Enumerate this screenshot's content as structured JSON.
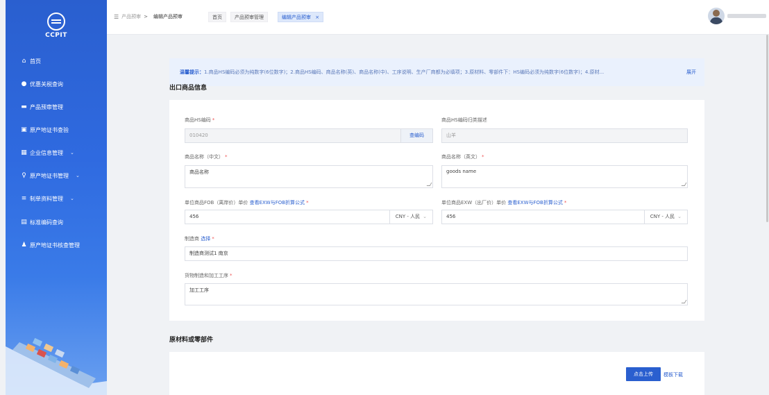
{
  "sidebar": {
    "logo_text": "CCPIT",
    "items": [
      {
        "label": "首页",
        "icon": "home-icon"
      },
      {
        "label": "优惠关税查询",
        "icon": "search-icon"
      },
      {
        "label": "产品预审管理",
        "icon": "folder-icon"
      },
      {
        "label": "原产地证书查验",
        "icon": "document-check-icon"
      },
      {
        "label": "企业信息管理",
        "icon": "building-icon"
      },
      {
        "label": "原产地证书管理",
        "icon": "user-cert-icon"
      },
      {
        "label": "制单资料管理",
        "icon": "stack-icon"
      },
      {
        "label": "标准编码查询",
        "icon": "code-icon"
      },
      {
        "label": "原产地证书核查管理",
        "icon": "person-icon"
      }
    ]
  },
  "header": {
    "breadcrumb_parent": "产品预审",
    "breadcrumb_separator": ">",
    "breadcrumb_current": "编辑产品预审",
    "tabs": [
      {
        "label": "首页"
      },
      {
        "label": "产品预审管理"
      },
      {
        "label": "编辑产品预审",
        "close": "×"
      }
    ]
  },
  "notice": {
    "lead": "温馨提示：",
    "text": "1.商品HS编码必须为纯数字(6位数字)；2.商品HS编码、商品名称(英)、商品名称(中)、工序说明、生产厂商都为必填项；3.原材料、零部件下：HS编码必须为纯数字(6位数字)；4.原材...",
    "expand": "展开"
  },
  "section1": {
    "title": "出口商品信息",
    "hs_code_label": "商品HS编码",
    "hs_code_value": "010420",
    "hs_code_button": "查编码",
    "hs_desc_label": "商品HS编码归类描述",
    "hs_desc_value": "山羊",
    "name_cn_label": "商品名称（中文）",
    "name_cn_value": "商品名称",
    "name_en_label": "商品名称（英文）",
    "name_en_value": "goods name",
    "fob_label": "单位商品FOB（离岸价）单价",
    "fob_link": "查看EXW与FOB折算公式",
    "fob_value": "456",
    "fob_currency": "CNY - 人民",
    "exw_label": "单位商品EXW（出厂价）单价",
    "exw_link": "查看EXW与FOB折算公式",
    "exw_value": "456",
    "exw_currency": "CNY - 人民",
    "maker_label": "制造商",
    "maker_link": "选择",
    "maker_value": "制造商测试1 南京",
    "process_label": "货物制造和加工工序",
    "process_value": "加工工序",
    "required_mark": "*"
  },
  "section2": {
    "title": "原材料或零部件",
    "upload_button": "点击上传",
    "template_link": "模板下载"
  },
  "colors": {
    "primary": "#2a5fcf",
    "sidebar_top": "#2a5fcf",
    "notice_bg": "#eaf1fd",
    "required": "#e55555"
  }
}
